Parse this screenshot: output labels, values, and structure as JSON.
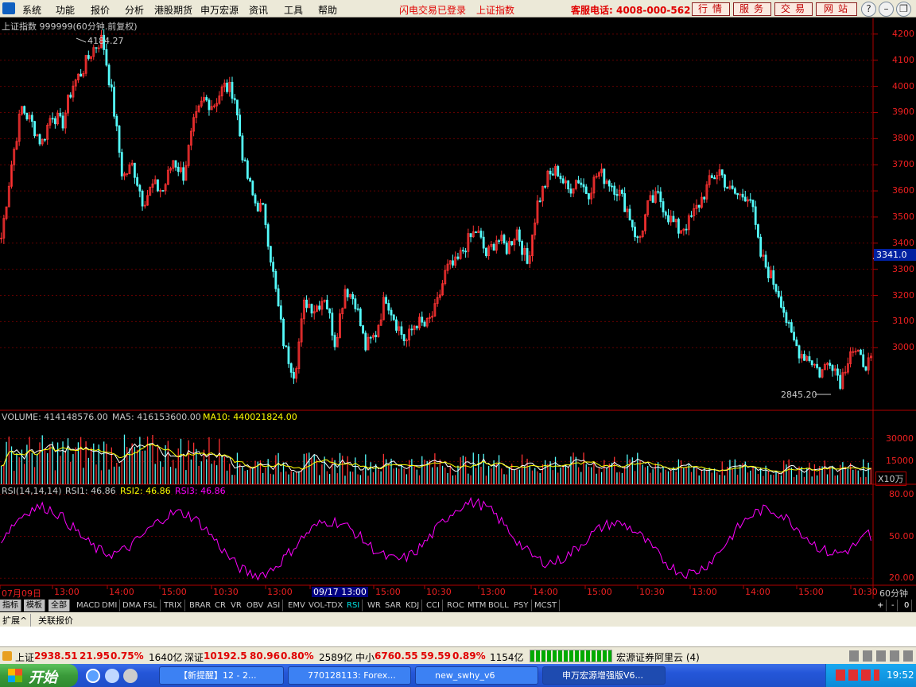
{
  "menu": {
    "items": [
      "系统",
      "功能",
      "报价",
      "分析",
      "港股期货",
      "申万宏源",
      "资讯",
      "工具",
      "帮助"
    ],
    "notice1": "闪电交易已登录",
    "notice2": "上证指数",
    "hotline": "客服电话: 4008-000-562",
    "buttons": [
      "行情",
      "服务",
      "交易",
      "网站"
    ]
  },
  "chart_header": {
    "title": "上证指数 999999(60分钟.前复权)",
    "high_label": "4184.27",
    "low_label": "2845.20",
    "current_price": "3341.0"
  },
  "price_axis": [
    "4200",
    "4100",
    "4000",
    "3900",
    "3800",
    "3700",
    "3600",
    "3500",
    "3400",
    "3300",
    "3200",
    "3100",
    "3000"
  ],
  "volume_header": {
    "vol": "VOLUME: 414148576.00",
    "ma5": "MA5: 416153600.00",
    "ma10": "MA10: 440021824.00"
  },
  "volume_axis": [
    "30000",
    "15000"
  ],
  "volume_unit": "X10万",
  "rsi_header": {
    "name": "RSI(14,14,14)",
    "rsi1": "RSI1: 46.86",
    "rsi2": "RSI2: 46.86",
    "rsi3": "RSI3: 46.86"
  },
  "rsi_axis": [
    "80.00",
    "50.00",
    "20.00"
  ],
  "time_axis": [
    "07月09日",
    "13:00",
    "14:00",
    "15:00",
    "10:30",
    "13:00",
    "09/17 13:00",
    "15:00",
    "10:30",
    "13:00",
    "14:00",
    "15:00",
    "10:30",
    "13:00",
    "14:00",
    "15:00",
    "10:30"
  ],
  "period": "60分钟",
  "indicators": [
    "指标",
    "模板",
    "全部",
    "MACD",
    "DMI",
    "DMA",
    "FSL",
    "TRIX",
    "BRAR",
    "CR",
    "VR",
    "OBV",
    "ASI",
    "EMV",
    "VOL-TDX",
    "RSI",
    "WR",
    "SAR",
    "KDJ",
    "CCI",
    "ROC",
    "MTM",
    "BOLL",
    "PSY",
    "MCST"
  ],
  "active_indicator": "RSI",
  "right_controls": [
    "+",
    "-",
    "0"
  ],
  "sub_tabs": [
    "扩展^",
    "关联报价"
  ],
  "status": {
    "sh_label": "上证",
    "sh_value": "2938.51",
    "sh_change": "21.95",
    "sh_pct": "0.75%",
    "sh_amount": "1640亿",
    "sz_label": "深证",
    "sz_value": "10192.5",
    "sz_change": "80.96",
    "sz_pct": "0.80%",
    "sz_amount": "2589亿",
    "zx_label": "中小",
    "zx_value": "6760.55",
    "zx_change": "59.59",
    "zx_pct": "0.89%",
    "zx_amount": "1154亿",
    "broker": "宏源证券阿里云 (4)"
  },
  "taskbar": {
    "start": "开始",
    "tasks": [
      "【新提醒】12 - 2...",
      "770128113: Forex...",
      "new_swhy_v6",
      "申万宏源增强版V6..."
    ],
    "clock": "19:52"
  },
  "colors": {
    "up": "#ff3232",
    "down": "#54fcfc",
    "ma5": "#ffffff",
    "ma10": "#ffff00",
    "rsi": "#ff00ff",
    "axis": "#b00000"
  },
  "chart_data": [
    {
      "type": "candlestick",
      "title": "上证指数 999999(60分钟.前复权)",
      "ylim": [
        2800,
        4230
      ],
      "high": 4184.27,
      "low": 2845.2,
      "last": 3341.0,
      "close_path": [
        3420,
        3700,
        3920,
        3860,
        3780,
        3900,
        3850,
        4000,
        4060,
        4140,
        4184,
        3950,
        3650,
        3700,
        3560,
        3620,
        3600,
        3720,
        3660,
        3850,
        3950,
        3930,
        4000,
        3980,
        3700,
        3560,
        3520,
        3250,
        3000,
        2900,
        3180,
        3150,
        3200,
        3020,
        3230,
        3180,
        3000,
        3050,
        3200,
        3100,
        3020,
        3100,
        3080,
        3150,
        3300,
        3320,
        3400,
        3450,
        3350,
        3420,
        3380,
        3450,
        3320,
        3550,
        3650,
        3680,
        3600,
        3650,
        3590,
        3670,
        3640,
        3600,
        3520,
        3400,
        3550,
        3580,
        3500,
        3450,
        3480,
        3550,
        3630,
        3680,
        3600,
        3580,
        3590,
        3360,
        3280,
        3200,
        3050,
        2980,
        2960,
        2900,
        2960,
        2870,
        3000,
        2950,
        2938
      ]
    },
    {
      "type": "bar",
      "name": "VOLUME",
      "unit": "X10万",
      "ylim": [
        0,
        45000
      ],
      "ticks": [
        30000,
        15000
      ]
    },
    {
      "type": "line",
      "name": "RSI(14,14,14)",
      "ylim": [
        15,
        85
      ],
      "ticks": [
        80,
        50,
        20
      ],
      "series": [
        {
          "name": "RSI1",
          "last": 46.86
        },
        {
          "name": "RSI2",
          "last": 46.86
        },
        {
          "name": "RSI3",
          "last": 46.86
        }
      ]
    }
  ]
}
